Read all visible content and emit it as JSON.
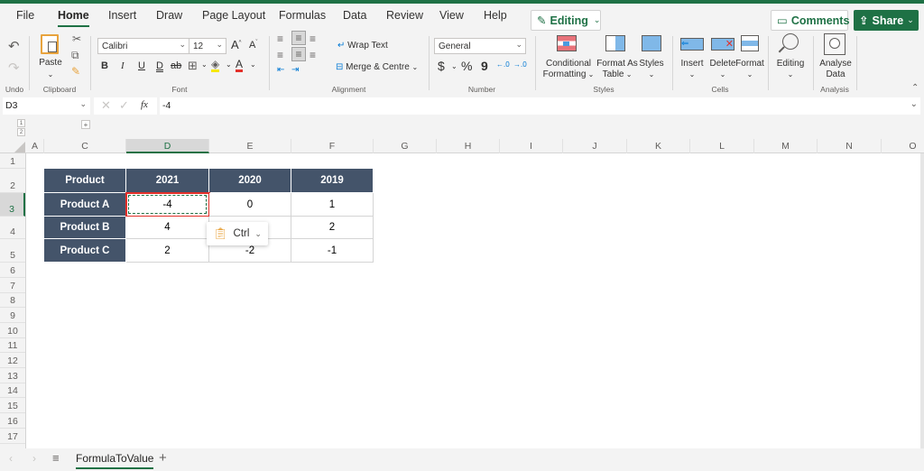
{
  "menu": {
    "tabs": [
      {
        "label": "File"
      },
      {
        "label": "Home"
      },
      {
        "label": "Insert"
      },
      {
        "label": "Draw"
      },
      {
        "label": "Page Layout"
      },
      {
        "label": "Formulas"
      },
      {
        "label": "Data"
      },
      {
        "label": "Review"
      },
      {
        "label": "View"
      },
      {
        "label": "Help"
      }
    ],
    "active_tab": "Home",
    "editing_label": "Editing",
    "comments_label": "Comments",
    "share_label": "Share"
  },
  "ribbon": {
    "undo_group": "Undo",
    "clipboard": {
      "group": "Clipboard",
      "paste": "Paste"
    },
    "font": {
      "group": "Font",
      "font_name": "Calibri",
      "font_size": "12",
      "bold": "B",
      "italic": "I",
      "underline": "U",
      "double_underline": "D",
      "strike": "ab",
      "font_color_letter": "A"
    },
    "alignment": {
      "group": "Alignment",
      "wrap_text": "Wrap Text",
      "merge_centre": "Merge & Centre"
    },
    "number": {
      "group": "Number",
      "format": "General",
      "currency": "$",
      "percent": "%",
      "comma": "9"
    },
    "styles": {
      "group": "Styles",
      "conditional_1": "Conditional",
      "conditional_2": "Formatting",
      "format_table_1": "Format As",
      "format_table_2": "Table",
      "styles": "Styles"
    },
    "cells": {
      "group": "Cells",
      "insert": "Insert",
      "delete": "Delete",
      "format": "Format"
    },
    "editing": {
      "label": "Editing"
    },
    "analysis": {
      "group": "Analysis",
      "analyse_1": "Analyse",
      "analyse_2": "Data"
    }
  },
  "formula_bar": {
    "name_box": "D3",
    "formula": "-4",
    "fx": "fx"
  },
  "outline": {
    "level1": "1",
    "level2": "2",
    "expand": "+"
  },
  "columns": [
    "A",
    "C",
    "D",
    "E",
    "F",
    "G",
    "H",
    "I",
    "J",
    "K",
    "L",
    "M",
    "N",
    "O"
  ],
  "selected_column": "D",
  "rows": [
    "1",
    "2",
    "3",
    "4",
    "5",
    "6",
    "7",
    "8",
    "9",
    "10",
    "11",
    "12",
    "13",
    "14",
    "15",
    "16",
    "17"
  ],
  "selected_row": "3",
  "table": {
    "headers": [
      "Product",
      "2021",
      "2020",
      "2019"
    ],
    "rows": [
      [
        "Product A",
        "-4",
        "0",
        "1"
      ],
      [
        "Product B",
        "4",
        "",
        "2"
      ],
      [
        "Product C",
        "2",
        "-2",
        "-1"
      ]
    ]
  },
  "paste_popup": {
    "label": "Ctrl"
  },
  "sheets": {
    "active": "FormulaToValue",
    "add": "+"
  }
}
